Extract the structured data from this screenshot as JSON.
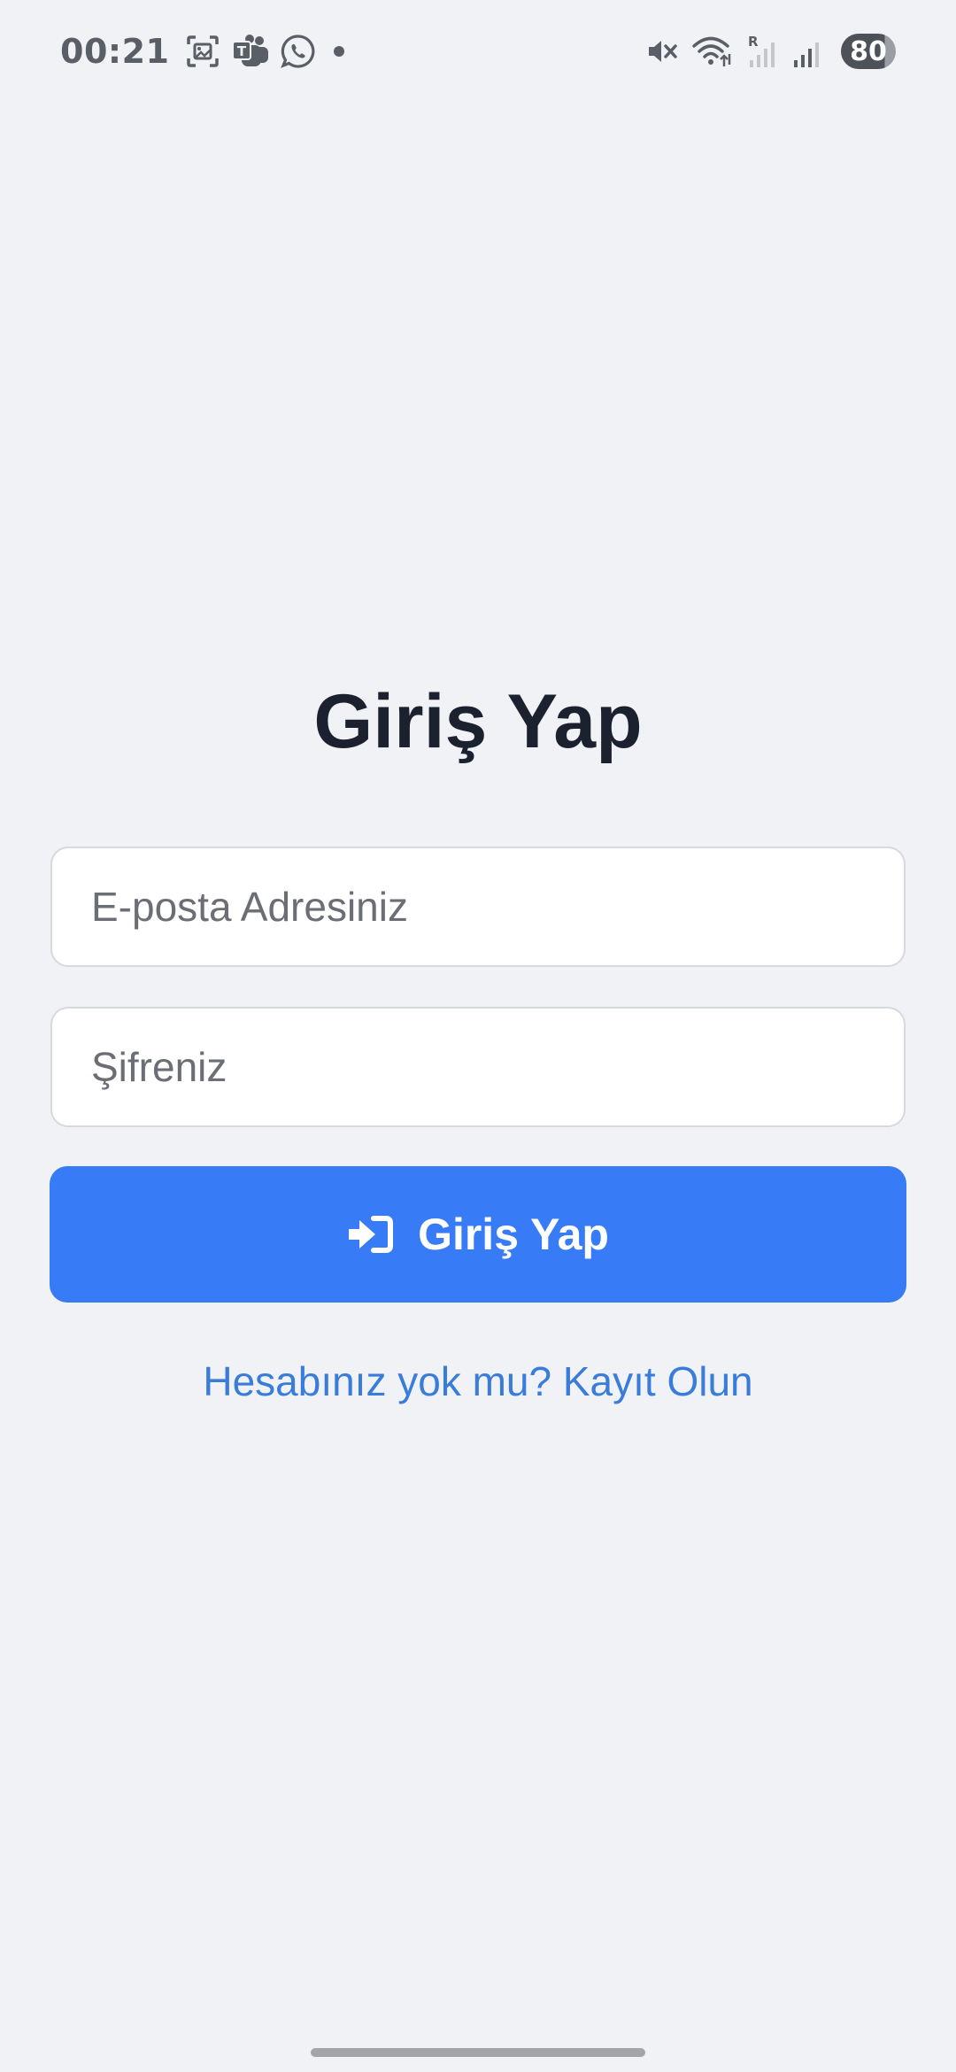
{
  "status_bar": {
    "time": "00:21",
    "battery": "80",
    "roaming": "R",
    "icons": [
      "gallery-scan-icon",
      "teams-icon",
      "whatsapp-icon",
      "notification-dot",
      "mute-icon",
      "wifi-icon",
      "signal-roaming-icon",
      "signal-icon",
      "battery-icon"
    ]
  },
  "login": {
    "title": "Giriş Yap",
    "email_placeholder": "E-posta Adresiniz",
    "email_value": "",
    "password_placeholder": "Şifreniz",
    "password_value": "",
    "submit_label": "Giriş Yap",
    "submit_icon": "sign-in-icon",
    "register_link": "Hesabınız yok mu? Kayıt Olun"
  },
  "colors": {
    "background": "#f0f2f6",
    "primary": "#377cf6",
    "link": "#3a7cd9",
    "title": "#1c2130"
  }
}
